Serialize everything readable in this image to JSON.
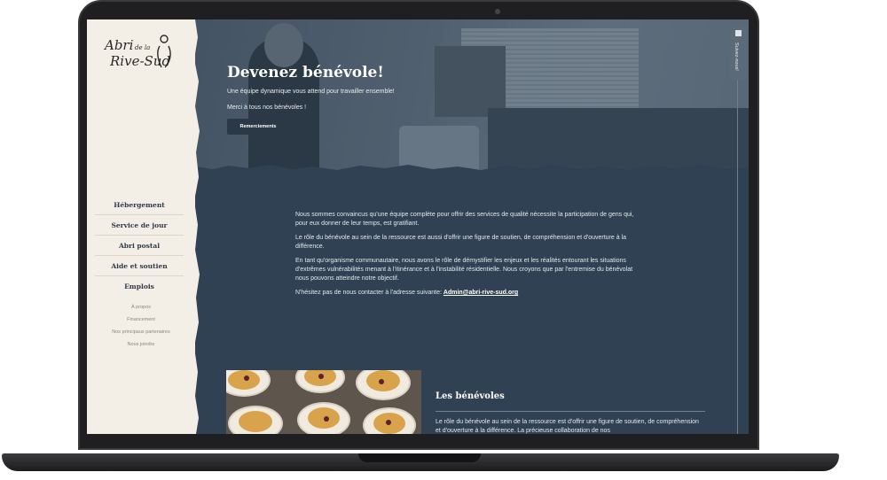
{
  "logo": {
    "line1": "Abri",
    "line1_small": "de la",
    "line2": "Rive-Sud"
  },
  "sidebar": {
    "main_items": [
      {
        "label": "Hébergement"
      },
      {
        "label": "Service de jour"
      },
      {
        "label": "Abri postal"
      },
      {
        "label": "Aide et soutien"
      },
      {
        "label": "Emplois"
      }
    ],
    "secondary_items": [
      {
        "label": "À propos"
      },
      {
        "label": "Financement"
      },
      {
        "label": "Nos principaux partenaires"
      },
      {
        "label": "Nous joindre"
      }
    ]
  },
  "hero": {
    "title": "Devenez bénévole!",
    "subtitle": "Une équipe dynamique vous attend pour travailler ensemble!",
    "thanks": "Merci à tous nos bénévoles !",
    "button_label": "Remerciements"
  },
  "follow_tab": {
    "label": "Suivez-nous!",
    "icon": "facebook-icon"
  },
  "content": {
    "paragraphs": [
      "Nous sommes convaincus qu'une équipe complète pour offrir des services de qualité nécessite la participation de gens qui, pour eux donner de leur temps, est gratifiant.",
      "Le rôle du bénévole au sein de la ressource est aussi d'offrir une figure de soutien, de compréhension et d'ouverture à la différence.",
      "En tant qu'organisme communautaire, nous avons le rôle de démystifier les enjeux et les réalités entourant les situations d'extrêmes vulnérabilités menant à l'itinérance et à l'instabilité résidentielle. Nous croyons que par l'entremise du bénévolat nous pouvons atteindre notre objectif."
    ],
    "contact_prefix": "N'hésitez pas de nous contacter à l'adresse suivante: ",
    "contact_email": "Admin@abri-rive-sud.org"
  },
  "benevoles_section": {
    "title": "Les bénévoles",
    "text": "Le rôle du bénévole au sein de la ressource est d'offrir une figure de soutien, de compréhension et d'ouverture à la différence. La précieuse collaboration de nos"
  },
  "colors": {
    "page_bg": "#2f4152",
    "sidebar_bg": "#f3eee6",
    "button_bg": "#2b3947"
  }
}
